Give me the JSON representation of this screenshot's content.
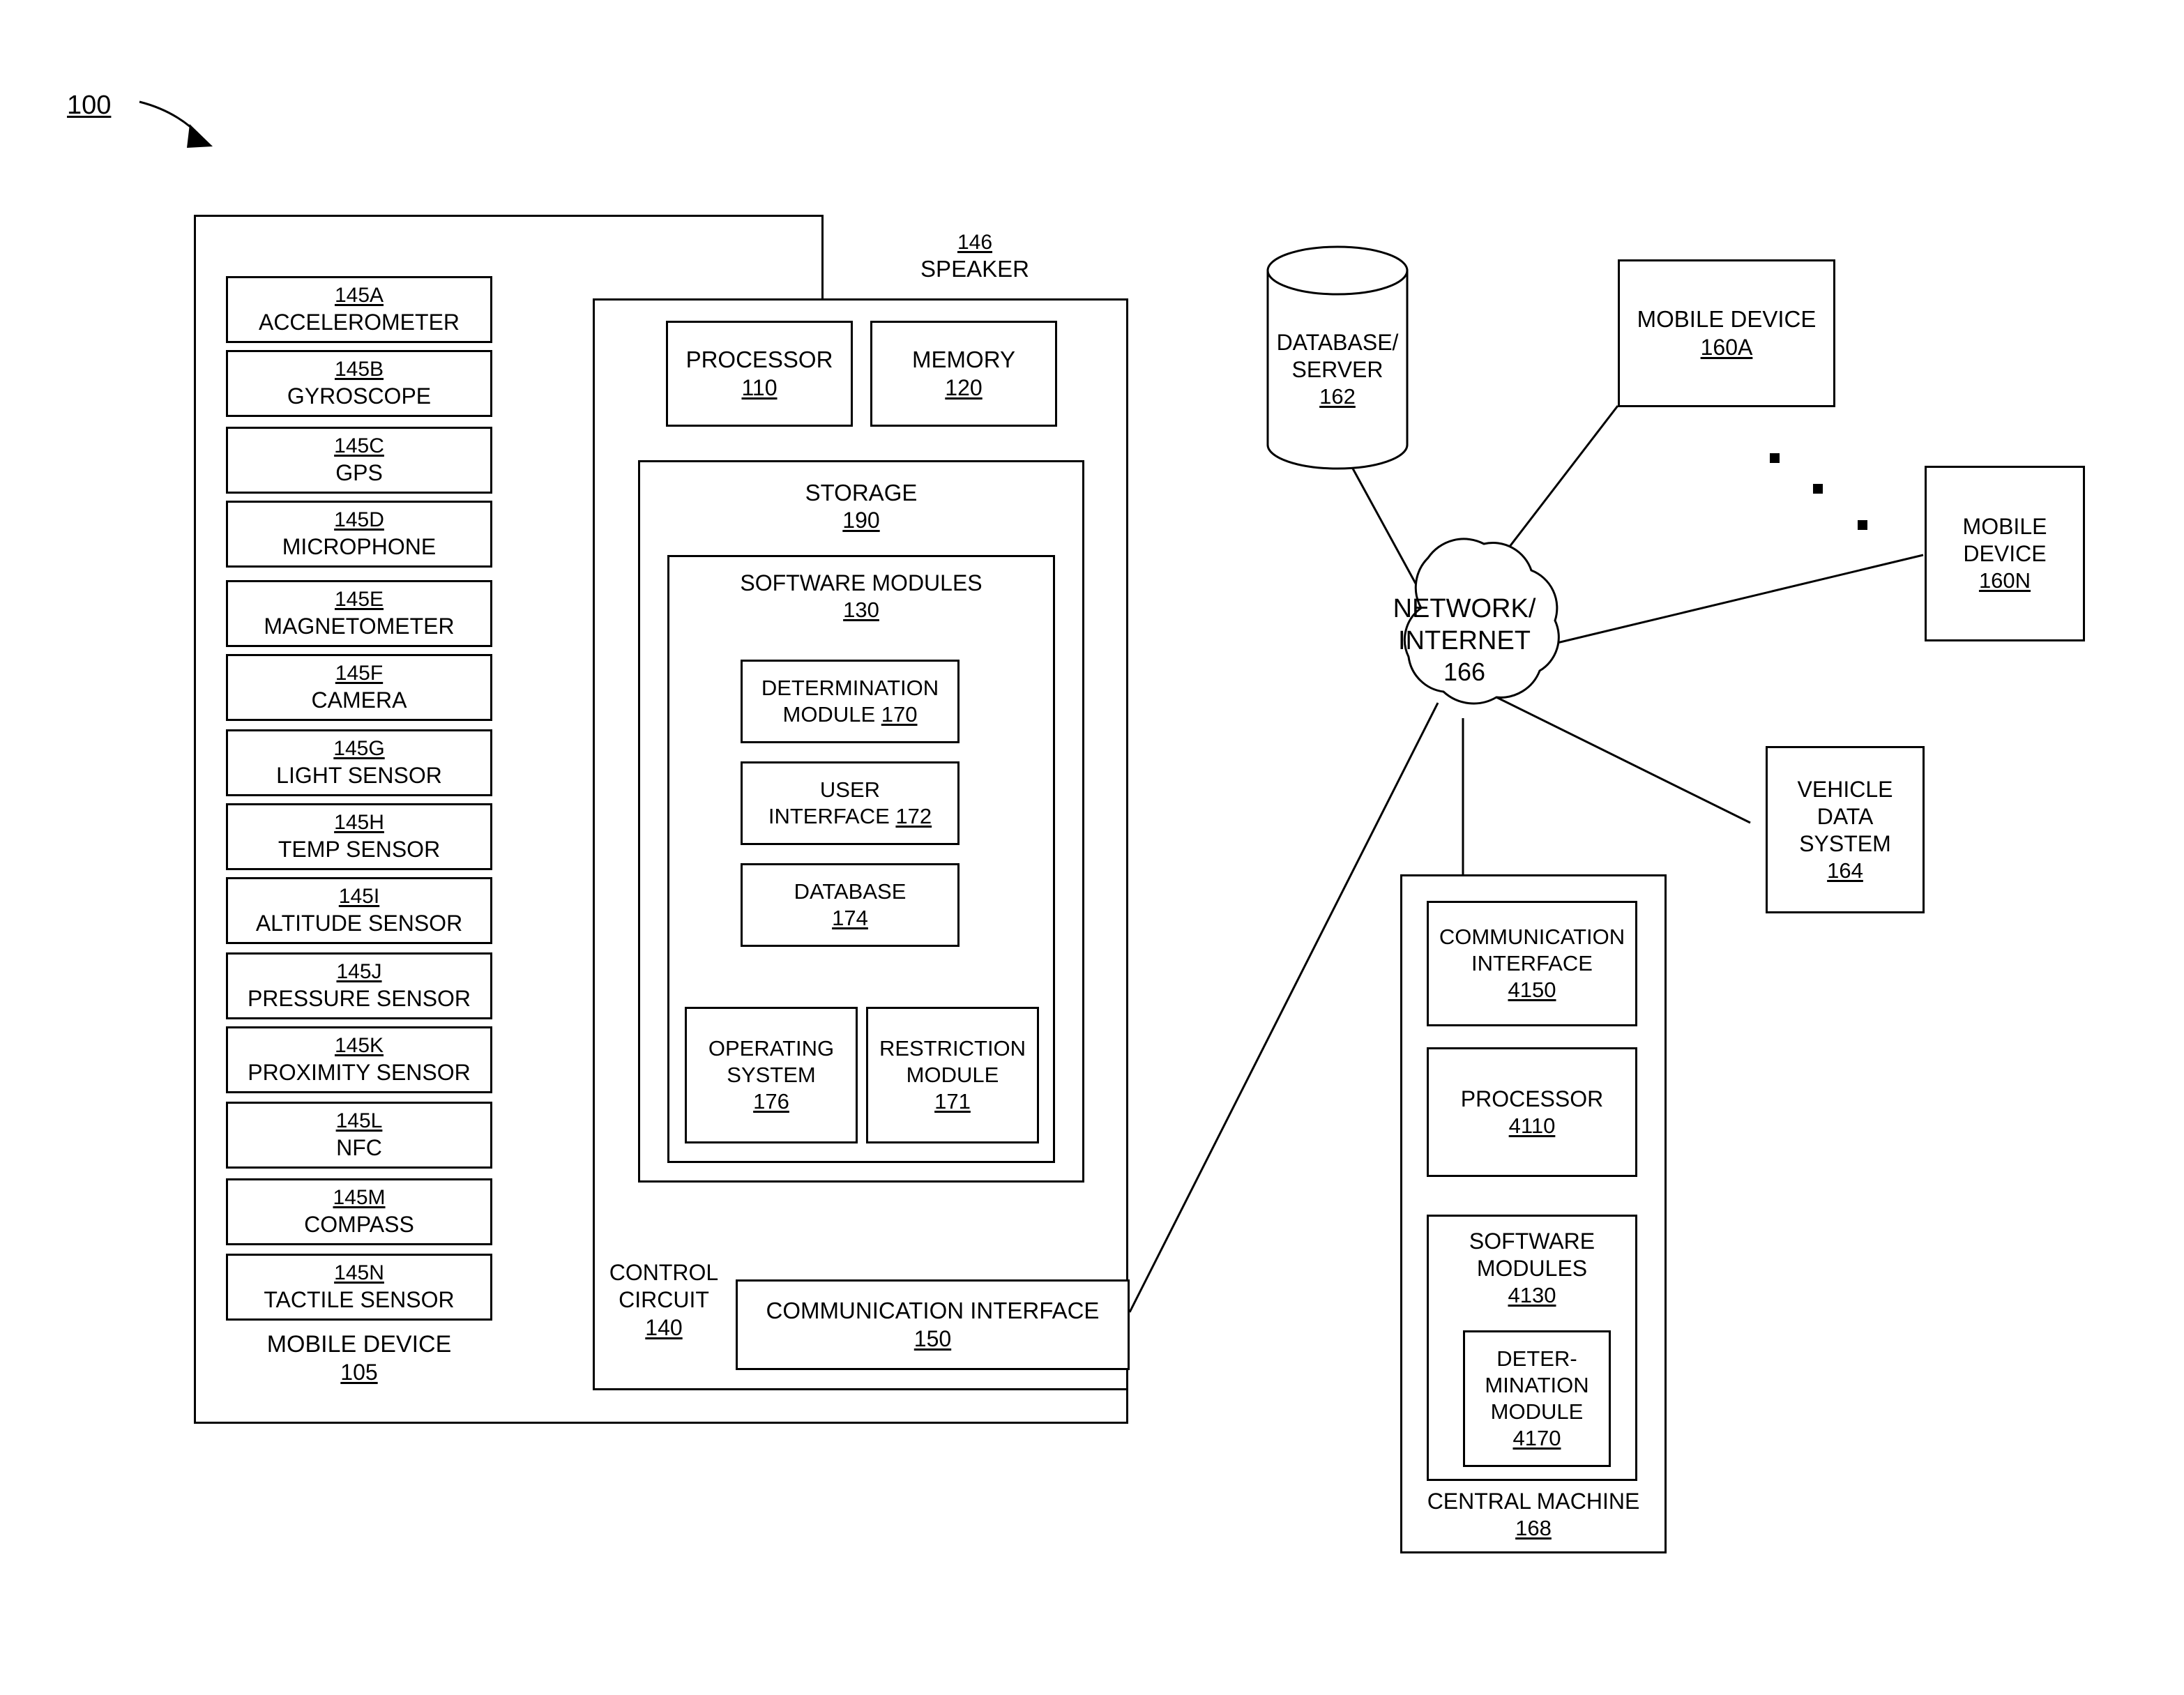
{
  "figure": {
    "ref_number": "100"
  },
  "mobile_device": {
    "title": "MOBILE DEVICE",
    "ref": "105",
    "speaker": {
      "ref": "146",
      "label": "SPEAKER"
    },
    "sensors": [
      {
        "ref": "145A",
        "label": "ACCELEROMETER"
      },
      {
        "ref": "145B",
        "label": "GYROSCOPE"
      },
      {
        "ref": "145C",
        "label": "GPS"
      },
      {
        "ref": "145D",
        "label": "MICROPHONE"
      },
      {
        "ref": "145E",
        "label": "MAGNETOMETER"
      },
      {
        "ref": "145F",
        "label": "CAMERA"
      },
      {
        "ref": "145G",
        "label": "LIGHT SENSOR"
      },
      {
        "ref": "145H",
        "label": "TEMP SENSOR"
      },
      {
        "ref": "145I",
        "label": "ALTITUDE SENSOR"
      },
      {
        "ref": "145J",
        "label": "PRESSURE SENSOR"
      },
      {
        "ref": "145K",
        "label": "PROXIMITY SENSOR"
      },
      {
        "ref": "145L",
        "label": "NFC"
      },
      {
        "ref": "145M",
        "label": "COMPASS"
      },
      {
        "ref": "145N",
        "label": "TACTILE SENSOR"
      }
    ],
    "control_circuit": {
      "label_line1": "CONTROL",
      "label_line2": "CIRCUIT",
      "ref": "140",
      "processor": {
        "label": "PROCESSOR",
        "ref": "110"
      },
      "memory": {
        "label": "MEMORY",
        "ref": "120"
      },
      "storage": {
        "label": "STORAGE",
        "ref": "190",
        "software_modules": {
          "label": "SOFTWARE MODULES",
          "ref": "130",
          "determination_module": {
            "line1": "DETERMINATION",
            "line2": "MODULE",
            "ref": "170"
          },
          "user_interface": {
            "line1": "USER",
            "line2": "INTERFACE",
            "ref": "172"
          },
          "database": {
            "label": "DATABASE",
            "ref": "174"
          },
          "operating_system": {
            "line1": "OPERATING",
            "line2": "SYSTEM",
            "ref": "176"
          },
          "restriction_module": {
            "line1": "RESTRICTION",
            "line2": "MODULE",
            "ref": "171"
          }
        }
      },
      "communication_interface": {
        "label": "COMMUNICATION INTERFACE",
        "ref": "150"
      }
    }
  },
  "network": {
    "database_server": {
      "line1": "DATABASE/",
      "line2": "SERVER",
      "ref": "162"
    },
    "cloud": {
      "line1": "NETWORK/",
      "line2": "INTERNET",
      "ref": "166"
    },
    "mobile_device_a": {
      "label": "MOBILE DEVICE",
      "ref": "160A"
    },
    "mobile_device_n": {
      "line1": "MOBILE",
      "line2": "DEVICE",
      "ref": "160N"
    },
    "vehicle_data_system": {
      "line1": "VEHICLE",
      "line2": "DATA",
      "line3": "SYSTEM",
      "ref": "164"
    },
    "ellipsis_dots": 3
  },
  "central_machine": {
    "title": "CENTRAL MACHINE",
    "ref": "168",
    "communication_interface": {
      "line1": "COMMUNICATION",
      "line2": "INTERFACE",
      "ref": "4150"
    },
    "processor": {
      "label": "PROCESSOR",
      "ref": "4110"
    },
    "software_modules": {
      "line1": "SOFTWARE",
      "line2": "MODULES",
      "ref": "4130",
      "determination_module": {
        "line1": "DETER-",
        "line2": "MINATION",
        "line3": "MODULE",
        "ref": "4170"
      }
    }
  },
  "colors": {
    "stroke": "#000000",
    "background": "#ffffff"
  }
}
